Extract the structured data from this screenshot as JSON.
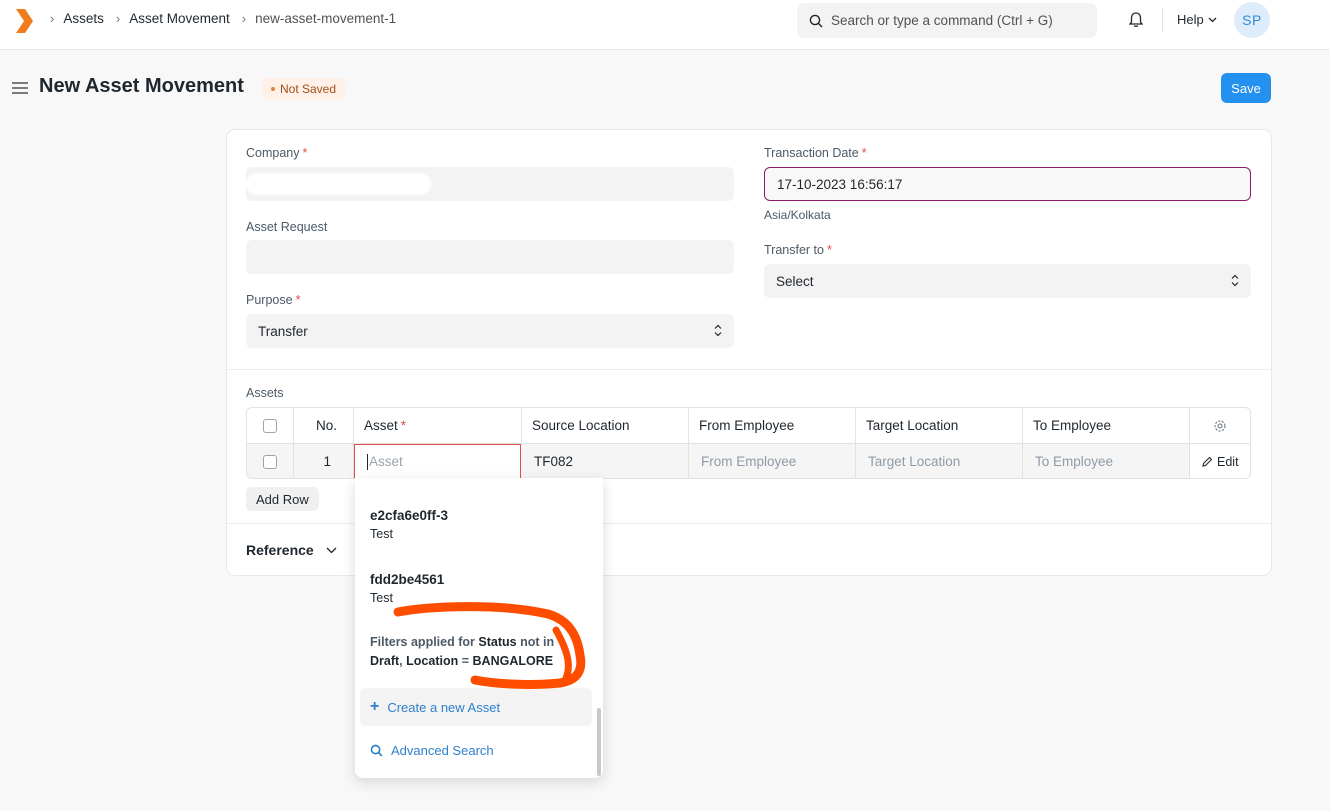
{
  "navbar": {
    "breadcrumbs": [
      "Assets",
      "Asset Movement",
      "new-asset-movement-1"
    ],
    "search_placeholder": "Search or type a command (Ctrl + G)",
    "help_label": "Help",
    "avatar_initials": "SP"
  },
  "header": {
    "title": "New Asset Movement",
    "status": "Not Saved",
    "save_label": "Save"
  },
  "form": {
    "company": {
      "label": "Company",
      "value": ""
    },
    "asset_request": {
      "label": "Asset Request",
      "value": ""
    },
    "purpose": {
      "label": "Purpose",
      "value": "Transfer"
    },
    "transaction_date": {
      "label": "Transaction Date",
      "value": "17-10-2023 16:56:17",
      "timezone": "Asia/Kolkata"
    },
    "transfer_to": {
      "label": "Transfer to",
      "value": "Select"
    }
  },
  "assets_table": {
    "label": "Assets",
    "columns": [
      "No.",
      "Asset",
      "Source Location",
      "From Employee",
      "Target Location",
      "To Employee"
    ],
    "rows": [
      {
        "no": "1",
        "asset_placeholder": "Asset",
        "source_location": "TF082",
        "from_employee": "From Employee",
        "target_location": "Target Location",
        "to_employee": "To Employee",
        "edit_label": "Edit"
      }
    ],
    "add_row_label": "Add Row"
  },
  "reference_section": {
    "label": "Reference"
  },
  "asset_dropdown": {
    "options": [
      {
        "title": "e2cfa6e0ff-3",
        "subtitle": "Test"
      },
      {
        "title": "fdd2be4561",
        "subtitle": "Test"
      }
    ],
    "filter_prefix": "Filters applied for",
    "filter_field_1": "Status",
    "filter_mid_1": "not in",
    "filter_value_1": "Draft",
    "filter_sep": ",",
    "filter_field_2": "Location",
    "filter_mid_2": "=",
    "filter_value_2": "BANGALORE",
    "create_label": "Create a new Asset",
    "advanced_label": "Advanced Search"
  },
  "colors": {
    "primary": "#2490ef",
    "link": "#2f80cc",
    "required": "#e24c4c",
    "focus_border": "#8c1a67",
    "annotation": "#ff4d00"
  }
}
